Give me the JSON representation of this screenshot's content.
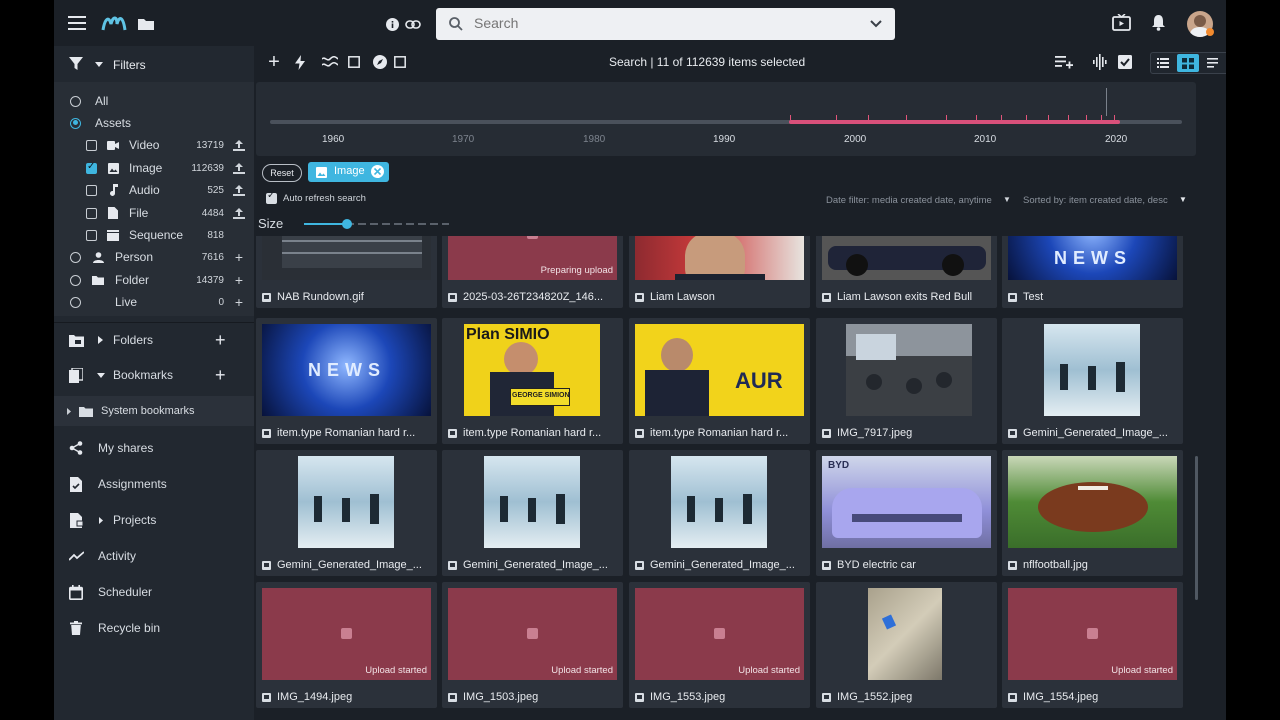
{
  "search": {
    "placeholder": "Search"
  },
  "toolbar": {
    "selection_text": "Search | 11 of 112639 items selected"
  },
  "sidebar": {
    "filters_label": "Filters",
    "assets": [
      {
        "label": "All",
        "kind": "radio",
        "checked": false
      },
      {
        "label": "Assets",
        "kind": "radio",
        "checked": true
      }
    ],
    "asset_types": [
      {
        "label": "Video",
        "count": "13719",
        "checked": false,
        "icon": "video-icon"
      },
      {
        "label": "Image",
        "count": "112639",
        "checked": true,
        "icon": "image-icon"
      },
      {
        "label": "Audio",
        "count": "525",
        "checked": false,
        "icon": "music-note-icon"
      },
      {
        "label": "File",
        "count": "4484",
        "checked": false,
        "icon": "file-icon"
      },
      {
        "label": "Sequence",
        "count": "818",
        "checked": false,
        "icon": "clapper-icon"
      }
    ],
    "entities": [
      {
        "label": "Person",
        "count": "7616"
      },
      {
        "label": "Folder",
        "count": "14379"
      },
      {
        "label": "Live",
        "count": "0"
      }
    ],
    "folders_label": "Folders",
    "bookmarks_label": "Bookmarks",
    "system_bookmarks_label": "System bookmarks",
    "nav": [
      {
        "label": "My shares",
        "icon": "share-icon"
      },
      {
        "label": "Assignments",
        "icon": "assignment-icon"
      },
      {
        "label": "Projects",
        "icon": "project-icon"
      },
      {
        "label": "Activity",
        "icon": "activity-icon"
      },
      {
        "label": "Scheduler",
        "icon": "calendar-icon"
      },
      {
        "label": "Recycle bin",
        "icon": "trash-icon"
      }
    ]
  },
  "timeline": {
    "ticks": [
      "1960",
      "1970",
      "1980",
      "1990",
      "2000",
      "2010",
      "2020"
    ]
  },
  "chips": {
    "reset": "Reset",
    "image": "Image"
  },
  "options": {
    "auto_refresh": "Auto refresh search",
    "size": "Size",
    "date_filter": "Date filter: media created date, anytime",
    "sorted_by": "Sorted by: item created date, desc"
  },
  "grid": [
    {
      "name": "NAB Rundown.gif",
      "thumb": "rundown"
    },
    {
      "name": "2025-03-26T234820Z_146...",
      "thumb": "pending",
      "status": "Preparing upload"
    },
    {
      "name": "Liam Lawson",
      "thumb": "lawson"
    },
    {
      "name": "Liam Lawson exits Red Bull",
      "thumb": "f1car"
    },
    {
      "name": "Test",
      "thumb": "news"
    },
    {
      "name": "item.type Romanian hard r...",
      "thumb": "news"
    },
    {
      "name": "item.type Romanian hard r...",
      "thumb": "simion"
    },
    {
      "name": "item.type Romanian hard r...",
      "thumb": "aur"
    },
    {
      "name": "IMG_7917.jpeg",
      "thumb": "meeting"
    },
    {
      "name": "Gemini_Generated_Image_...",
      "thumb": "snow"
    },
    {
      "name": "Gemini_Generated_Image_...",
      "thumb": "snow"
    },
    {
      "name": "Gemini_Generated_Image_...",
      "thumb": "snow"
    },
    {
      "name": "Gemini_Generated_Image_...",
      "thumb": "snow"
    },
    {
      "name": "BYD electric car",
      "thumb": "byd"
    },
    {
      "name": "nflfootball.jpg",
      "thumb": "football"
    },
    {
      "name": "IMG_1494.jpeg",
      "thumb": "pending",
      "status": "Upload started"
    },
    {
      "name": "IMG_1503.jpeg",
      "thumb": "pending",
      "status": "Upload started"
    },
    {
      "name": "IMG_1553.jpeg",
      "thumb": "pending",
      "status": "Upload started"
    },
    {
      "name": "IMG_1552.jpeg",
      "thumb": "photo"
    },
    {
      "name": "IMG_1554.jpeg",
      "thumb": "pending",
      "status": "Upload started"
    }
  ],
  "thumb_text": {
    "news": "NEWS",
    "simion_banner": "Plan SIMIO",
    "simion_podium": "GEORGE SIMION",
    "aur": "AUR",
    "byd": "BYD"
  }
}
